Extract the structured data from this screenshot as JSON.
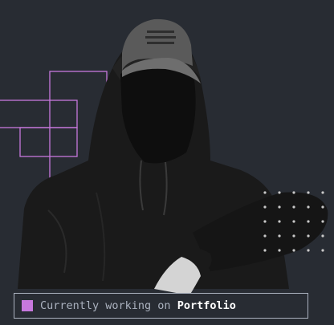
{
  "colors": {
    "background": "#282c33",
    "accent": "#c778dd",
    "text_muted": "#abb2bf",
    "text_strong": "#ffffff"
  },
  "status": {
    "prefix": "Currently working on ",
    "project": "Portfolio"
  },
  "image": {
    "subject": "person in dark hoodie and cap"
  }
}
